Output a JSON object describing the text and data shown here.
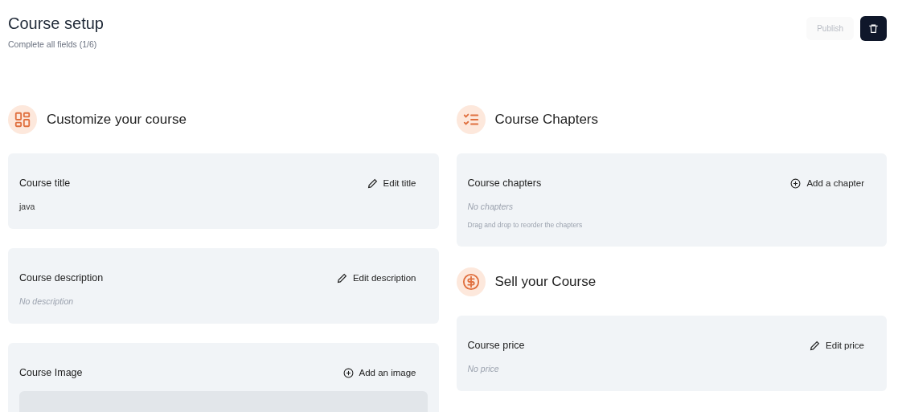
{
  "header": {
    "title": "Course setup",
    "subtitle": "Complete all fields (1/6)"
  },
  "toolbar": {
    "publish": {
      "label": "Publish",
      "disabled": true
    }
  },
  "columns": [
    {
      "sections": [
        {
          "title": "Customize your course",
          "kind": "customize",
          "cards": [
            {
              "kind": "text",
              "label": "Course title",
              "action": {
                "kind": "edit",
                "label": "Edit title"
              },
              "text": "java",
              "empty": false
            },
            {
              "kind": "text",
              "label": "Course description",
              "action": {
                "kind": "edit",
                "label": "Edit description"
              },
              "text": "No description",
              "empty": true
            },
            {
              "kind": "image",
              "label": "Course Image",
              "action": {
                "kind": "add",
                "label": "Add an image"
              }
            }
          ]
        }
      ]
    },
    {
      "sections": [
        {
          "title": "Course Chapters",
          "kind": "chapters",
          "cards": [
            {
              "kind": "chapters",
              "label": "Course chapters",
              "action": {
                "kind": "add",
                "label": "Add a chapter"
              },
              "text": "No chapters",
              "empty": true,
              "hint": "Drag and drop to reorder the chapters"
            }
          ]
        },
        {
          "title": "Sell your Course",
          "kind": "sell",
          "cards": [
            {
              "kind": "text",
              "label": "Course price",
              "action": {
                "kind": "edit",
                "label": "Edit price"
              },
              "text": "No price",
              "empty": true
            }
          ]
        }
      ]
    }
  ]
}
